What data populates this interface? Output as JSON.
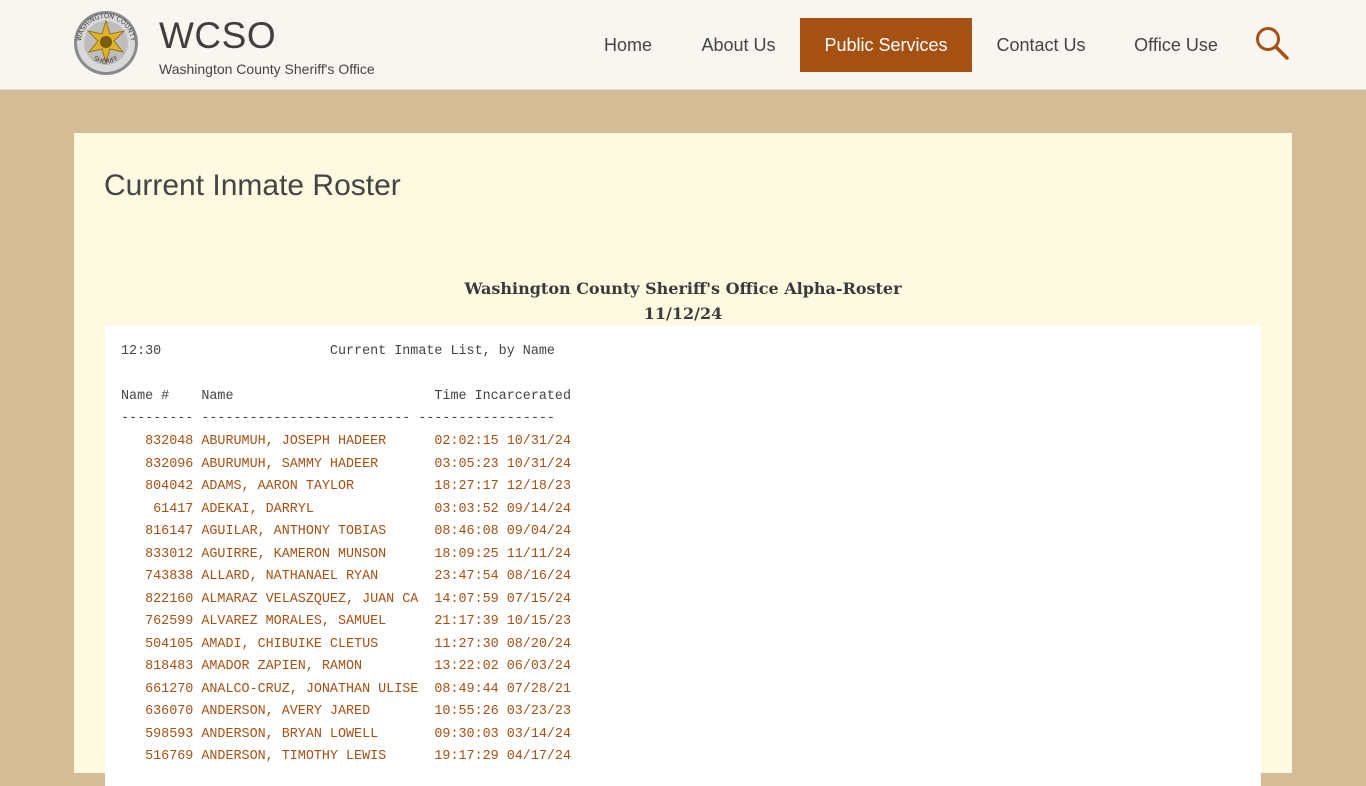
{
  "brand": {
    "title": "WCSO",
    "subtitle": "Washington County Sheriff's Office",
    "badge_top_text": "WASHINGTON COUNTY",
    "badge_bottom_text": "SHERIFF"
  },
  "nav": {
    "items": [
      {
        "label": "Home",
        "active": false
      },
      {
        "label": "About Us",
        "active": false
      },
      {
        "label": "Public Services",
        "active": true
      },
      {
        "label": "Contact Us",
        "active": false
      },
      {
        "label": "Office Use",
        "active": false
      }
    ]
  },
  "page": {
    "title": "Current Inmate Roster",
    "report_title": "Washington County Sheriff's Office Alpha-Roster",
    "report_date": "11/12/24"
  },
  "roster": {
    "header_line": "12:30                     Current Inmate List, by Name",
    "columns_line": "Name #    Name                         Time Incarcerated",
    "separator_line": "--------- -------------------------- -----------------",
    "rows": [
      "   832048 ABURUMUH, JOSEPH HADEER      02:02:15 10/31/24",
      "   832096 ABURUMUH, SAMMY HADEER       03:05:23 10/31/24",
      "   804042 ADAMS, AARON TAYLOR          18:27:17 12/18/23",
      "    61417 ADEKAI, DARRYL               03:03:52 09/14/24",
      "   816147 AGUILAR, ANTHONY TOBIAS      08:46:08 09/04/24",
      "   833012 AGUIRRE, KAMERON MUNSON      18:09:25 11/11/24",
      "   743838 ALLARD, NATHANAEL RYAN       23:47:54 08/16/24",
      "   822160 ALMARAZ VELASZQUEZ, JUAN CA  14:07:59 07/15/24",
      "   762599 ALVAREZ MORALES, SAMUEL      21:17:39 10/15/23",
      "   504105 AMADI, CHIBUIKE CLETUS       11:27:30 08/20/24",
      "   818483 AMADOR ZAPIEN, RAMON         13:22:02 06/03/24",
      "   661270 ANALCO-CRUZ, JONATHAN ULISE  08:49:44 07/28/21",
      "   636070 ANDERSON, AVERY JARED        10:55:26 03/23/23",
      "   598593 ANDERSON, BRYAN LOWELL       09:30:03 03/14/24",
      "   516769 ANDERSON, TIMOTHY LEWIS      19:17:29 04/17/24"
    ]
  },
  "colors": {
    "accent": "#a65114",
    "page_bg": "#d4bd96",
    "panel_bg": "#fefae1",
    "header_bg": "#f9f6f2"
  },
  "icons": {
    "search": "search-icon",
    "badge": "sheriff-badge-logo"
  }
}
